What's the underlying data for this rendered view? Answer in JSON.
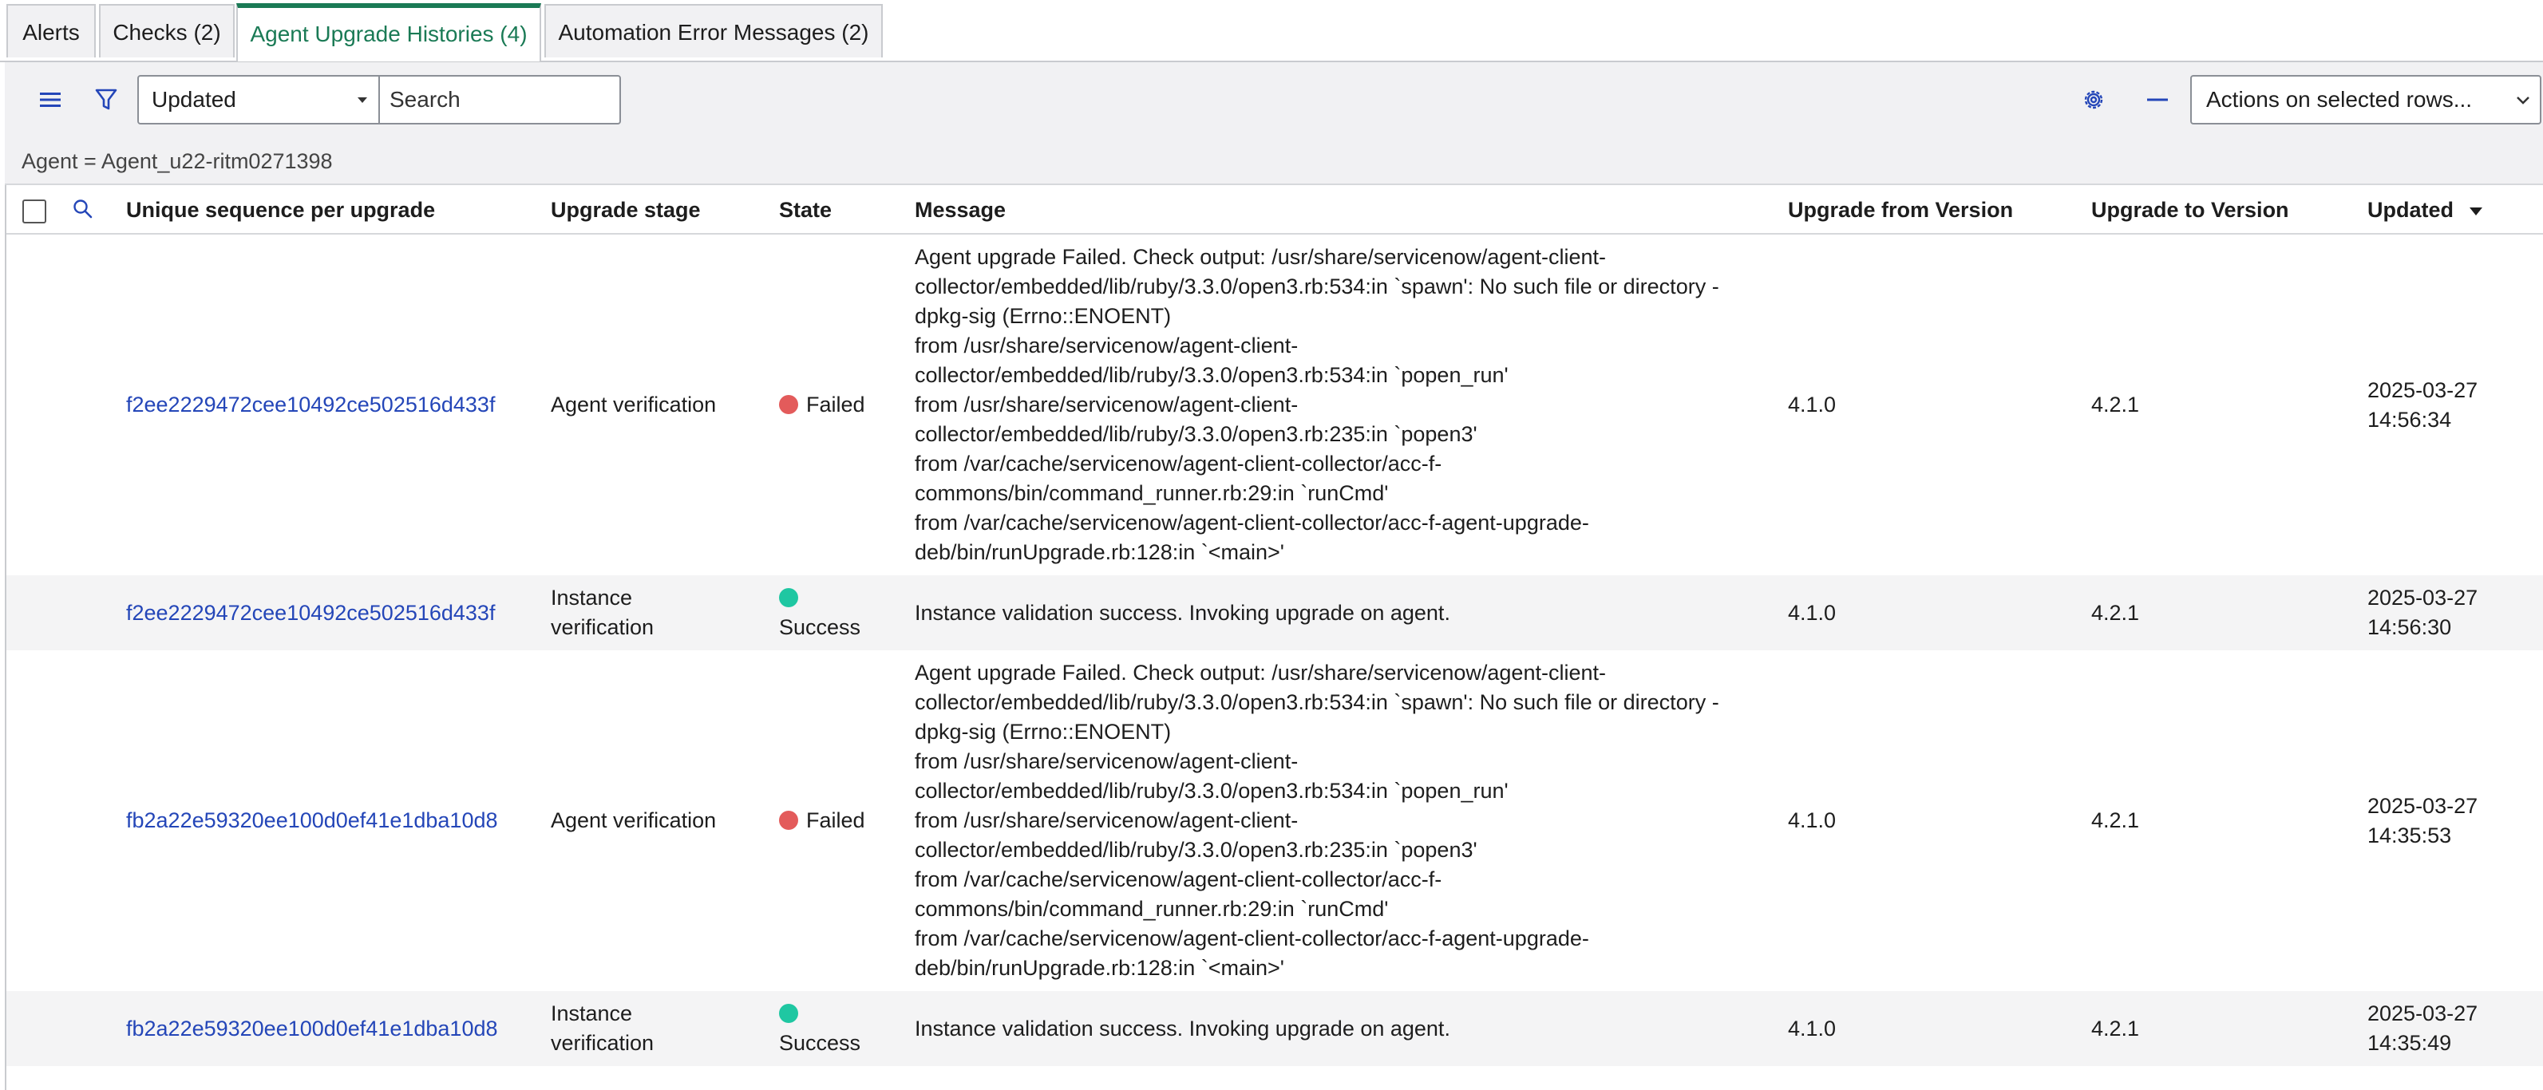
{
  "tabs": [
    {
      "label": "Alerts"
    },
    {
      "label": "Checks (2)"
    },
    {
      "label": "Agent Upgrade Histories (4)"
    },
    {
      "label": "Automation Error Messages (2)"
    }
  ],
  "active_tab": "Agent Upgrade Histories (4)",
  "toolbar": {
    "sort_field": "Updated",
    "search_placeholder": "Search",
    "actions_label": "Actions on selected rows...",
    "icons": [
      "list-menu-icon",
      "filter-icon",
      "gear-icon",
      "collapse-icon",
      "chevron-down-icon"
    ]
  },
  "breadcrumb": "Agent = Agent_u22-ritm0271398",
  "columns": {
    "sequence": "Unique sequence per upgrade",
    "stage": "Upgrade stage",
    "state": "State",
    "message": "Message",
    "from": "Upgrade from Version",
    "to": "Upgrade to Version",
    "updated": "Updated"
  },
  "colors": {
    "accent": "#1a7a55",
    "link": "#2446b8",
    "failed": "#e35b5b",
    "success": "#1fc7a2",
    "toolbar_bg": "#f1f1f3"
  },
  "rows": [
    {
      "sequence": "f2ee2229472cee10492ce502516d433f",
      "stage_lines": [
        "Agent verification"
      ],
      "state": "Failed",
      "status": "failed",
      "message_lines": [
        "Agent upgrade Failed. Check output: /usr/share/servicenow/agent-client-",
        "collector/embedded/lib/ruby/3.3.0/open3.rb:534:in `spawn': No such file or directory -",
        "dpkg-sig (Errno::ENOENT)",
        "from /usr/share/servicenow/agent-client-",
        "collector/embedded/lib/ruby/3.3.0/open3.rb:534:in `popen_run'",
        "from /usr/share/servicenow/agent-client-",
        "collector/embedded/lib/ruby/3.3.0/open3.rb:235:in `popen3'",
        "from /var/cache/servicenow/agent-client-collector/acc-f-",
        "commons/bin/command_runner.rb:29:in `runCmd'",
        "from /var/cache/servicenow/agent-client-collector/acc-f-agent-upgrade-",
        "deb/bin/runUpgrade.rb:128:in `<main>'"
      ],
      "from": "4.1.0",
      "to": "4.2.1",
      "updated_lines": [
        "2025-03-27",
        "14:56:34"
      ]
    },
    {
      "sequence": "f2ee2229472cee10492ce502516d433f",
      "stage_lines": [
        "Instance",
        "verification"
      ],
      "state": "Success",
      "status": "success",
      "message_lines": [
        "Instance validation success. Invoking upgrade on agent."
      ],
      "from": "4.1.0",
      "to": "4.2.1",
      "updated_lines": [
        "2025-03-27",
        "14:56:30"
      ]
    },
    {
      "sequence": "fb2a22e59320ee100d0ef41e1dba10d8",
      "stage_lines": [
        "Agent verification"
      ],
      "state": "Failed",
      "status": "failed",
      "message_lines": [
        "Agent upgrade Failed. Check output: /usr/share/servicenow/agent-client-",
        "collector/embedded/lib/ruby/3.3.0/open3.rb:534:in `spawn': No such file or directory -",
        "dpkg-sig (Errno::ENOENT)",
        "from /usr/share/servicenow/agent-client-",
        "collector/embedded/lib/ruby/3.3.0/open3.rb:534:in `popen_run'",
        "from /usr/share/servicenow/agent-client-",
        "collector/embedded/lib/ruby/3.3.0/open3.rb:235:in `popen3'",
        "from /var/cache/servicenow/agent-client-collector/acc-f-",
        "commons/bin/command_runner.rb:29:in `runCmd'",
        "from /var/cache/servicenow/agent-client-collector/acc-f-agent-upgrade-",
        "deb/bin/runUpgrade.rb:128:in `<main>'"
      ],
      "from": "4.1.0",
      "to": "4.2.1",
      "updated_lines": [
        "2025-03-27",
        "14:35:53"
      ]
    },
    {
      "sequence": "fb2a22e59320ee100d0ef41e1dba10d8",
      "stage_lines": [
        "Instance",
        "verification"
      ],
      "state": "Success",
      "status": "success",
      "message_lines": [
        "Instance validation success. Invoking upgrade on agent."
      ],
      "from": "4.1.0",
      "to": "4.2.1",
      "updated_lines": [
        "2025-03-27",
        "14:35:49"
      ]
    }
  ]
}
